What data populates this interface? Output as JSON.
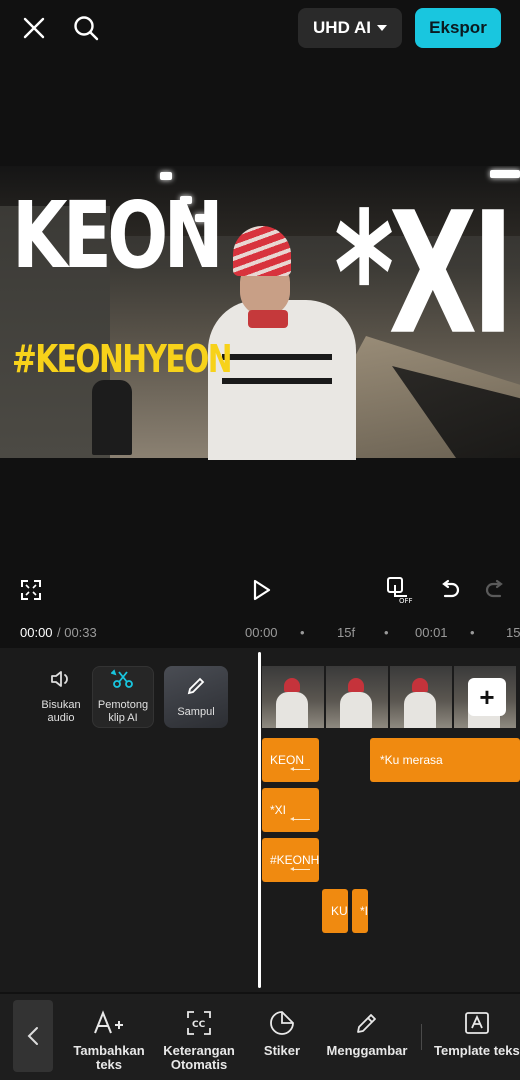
{
  "topbar": {
    "quality_label": "UHD AI",
    "export_label": "Ekspor"
  },
  "preview": {
    "overlay_title": "KEON",
    "overlay_hashtag": "#KEONHYEON",
    "overlay_right": "*XI"
  },
  "timeline": {
    "current_time": "00:00",
    "total_time": "/ 00:33",
    "ruler": [
      "00:00",
      "•",
      "15f",
      "•",
      "00:01",
      "•",
      "15f"
    ],
    "tools": {
      "mute_audio": "Bisukan audio",
      "ai_cutter": "Pemotong klip AI",
      "cover": "Sampul"
    },
    "text_clips": [
      "KEON",
      "*Ku merasa",
      "*XI",
      "#KEONH",
      "KU",
      "*I"
    ]
  },
  "bottom_toolbar": {
    "items": [
      {
        "label": "Tambahkan teks",
        "icon": "add-text-icon"
      },
      {
        "label": "Keterangan Otomatis",
        "icon": "auto-captions-icon"
      },
      {
        "label": "Stiker",
        "icon": "sticker-icon"
      },
      {
        "label": "Menggambar",
        "icon": "draw-pencil-icon"
      },
      {
        "label": "Template teks",
        "icon": "text-template-icon"
      }
    ]
  },
  "colors": {
    "accent": "#19c6df",
    "clip": "#f08a10",
    "hashtag": "#f7d21a",
    "background": "#111111"
  }
}
